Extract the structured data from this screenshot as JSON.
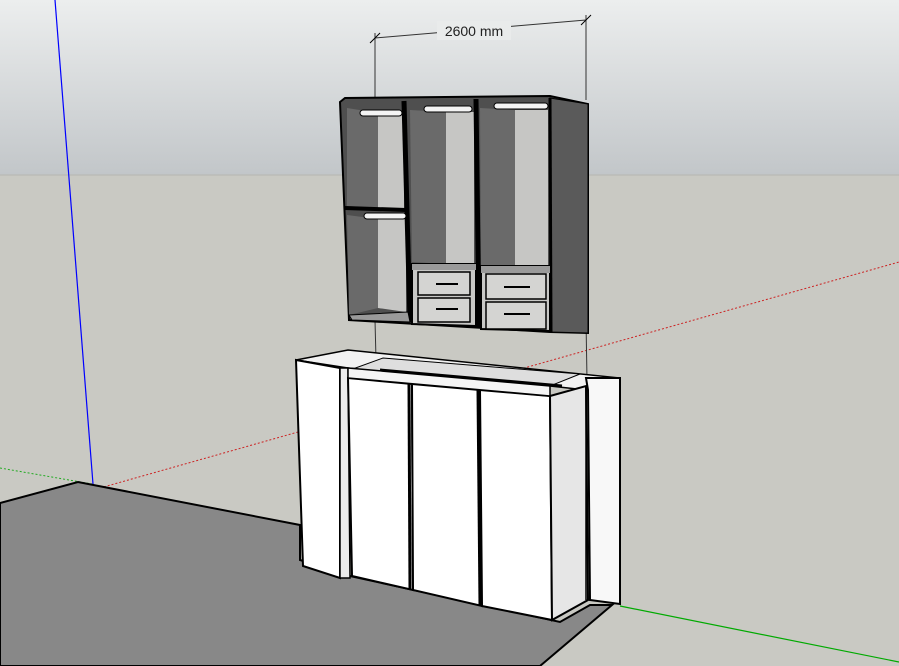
{
  "model": {
    "dimension_label": "2600 mm"
  },
  "colors": {
    "sky_top": "#e9ebeb",
    "sky_bottom": "#bfc4c7",
    "ground": "#c9c9c3",
    "floor_slab": "#8a8a8a",
    "upper_carcass_inner": "#5a5a5a",
    "upper_back_panel": "#c6c6c4",
    "wardrobe_front": "#ffffff",
    "wardrobe_side": "#e4e4e4",
    "outline": "#000000",
    "axis_blue": "#0000ff",
    "axis_red": "#cc0000",
    "axis_green": "#00aa00"
  },
  "axes": {
    "x_axis": "red",
    "y_axis": "green",
    "z_axis": "blue"
  }
}
